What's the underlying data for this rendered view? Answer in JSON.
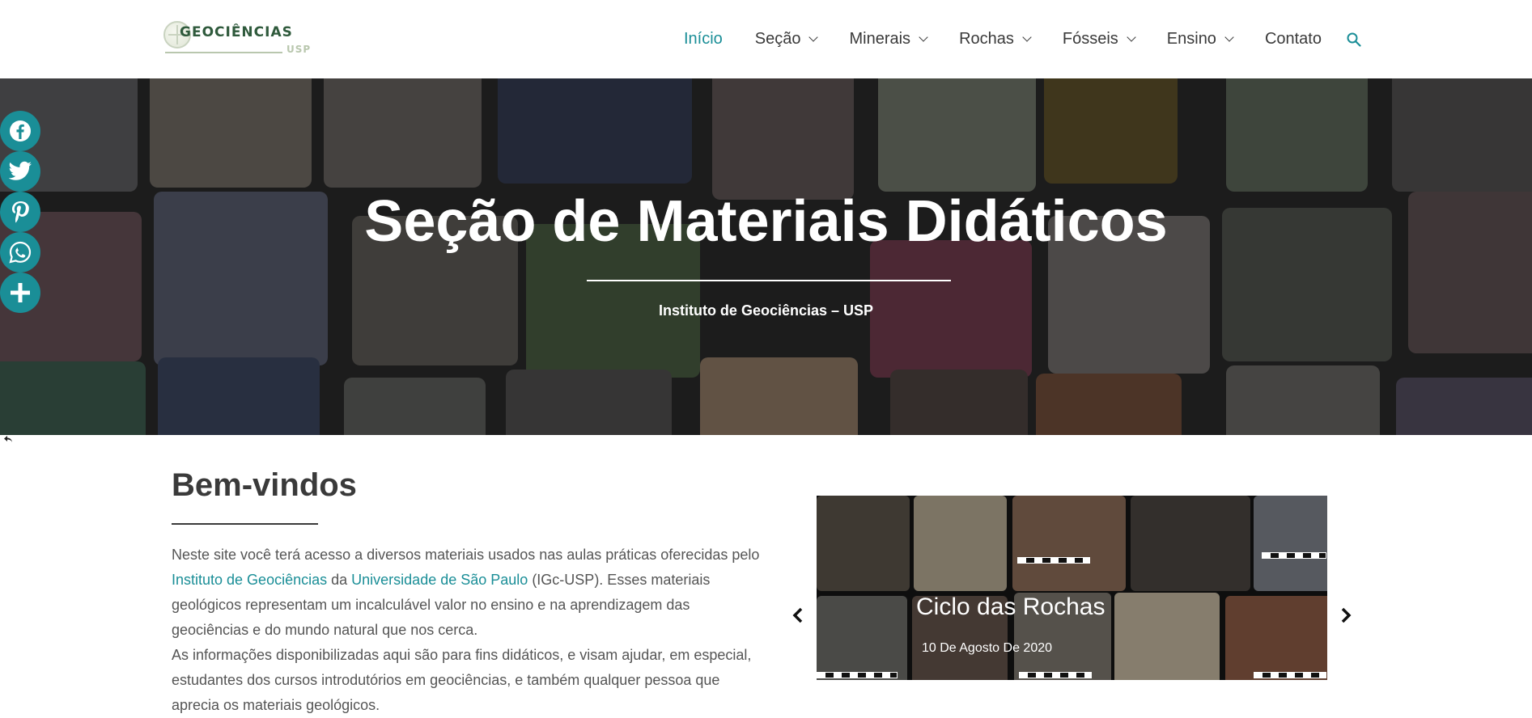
{
  "header": {
    "logo_name": "GEOCIÊNCIAS",
    "logo_sub": "USP",
    "nav": [
      {
        "label": "Início",
        "active": true,
        "dropdown": false
      },
      {
        "label": "Seção",
        "active": false,
        "dropdown": true
      },
      {
        "label": "Minerais",
        "active": false,
        "dropdown": true
      },
      {
        "label": "Rochas",
        "active": false,
        "dropdown": true
      },
      {
        "label": "Fósseis",
        "active": false,
        "dropdown": true
      },
      {
        "label": "Ensino",
        "active": false,
        "dropdown": true
      },
      {
        "label": "Contato",
        "active": false,
        "dropdown": false
      }
    ],
    "search_icon": "search-icon"
  },
  "hero": {
    "title": "Seção de Materiais Didáticos",
    "subtitle": "Instituto de Geociências – USP"
  },
  "social": {
    "icons": [
      "facebook-icon",
      "twitter-icon",
      "pinterest-icon",
      "whatsapp-icon",
      "plus-icon"
    ],
    "hide_icon": "hide-arrow-icon"
  },
  "welcome": {
    "title": "Bem-vindos",
    "p1_a": "Neste site você terá acesso a diversos materiais usados nas aulas práticas oferecidas pelo ",
    "link1": "Instituto de Geociências",
    "p1_b": " da ",
    "link2": "Universidade de São Paulo",
    "p1_c": " (IGc-USP). Esses materiais geológicos representam um incalculável valor no ensino e na aprendizagem das geociências e do mundo natural que nos cerca.",
    "p2": "As informações disponibilizadas aqui são para fins didáticos, e visam ajudar, em especial, estudantes dos cursos introdutórios em geociências, e também qualquer pessoa que aprecia os materiais geológicos."
  },
  "slider": {
    "title": "Ciclo das Rochas",
    "date": "10 De Agosto De 2020",
    "prev_icon": "chevron-left-icon",
    "next_icon": "chevron-right-icon"
  },
  "colors": {
    "accent": "#1a8e97",
    "text": "#3a3a3a",
    "body_text": "#555555",
    "hero_bg": "#1f1f1f"
  }
}
